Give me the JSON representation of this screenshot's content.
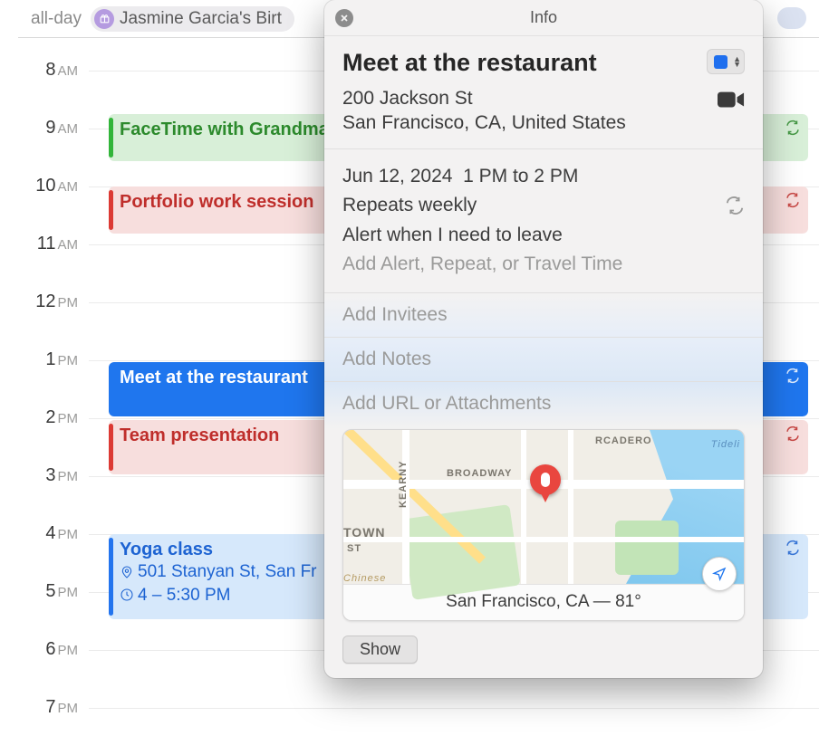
{
  "allDay": {
    "label": "all-day",
    "chip": "Jasmine Garcia's Birt"
  },
  "hours": [
    "8",
    "9",
    "10",
    "11",
    "12",
    "1",
    "2",
    "3",
    "4",
    "5",
    "6",
    "7"
  ],
  "ampm": [
    "AM",
    "AM",
    "AM",
    "AM",
    "PM",
    "PM",
    "PM",
    "PM",
    "PM",
    "PM",
    "PM",
    "PM"
  ],
  "events": {
    "facetime": "FaceTime with Grandma",
    "portfolio": "Portfolio work session",
    "meet": "Meet at the restaurant",
    "team": "Team presentation",
    "yoga": "Yoga class",
    "yoga_loc": "501 Stanyan St, San Fr",
    "yoga_time": "4 – 5:30 PM"
  },
  "pop": {
    "header": "Info",
    "title": "Meet at the restaurant",
    "addr1": "200 Jackson St",
    "addr2": "San Francisco, CA, United States",
    "date": "Jun 12, 2024",
    "time": "1 PM to 2 PM",
    "repeat": "Repeats weekly",
    "alert": "Alert when I need to leave",
    "addAlert": "Add Alert, Repeat, or Travel Time",
    "invitees": "Add Invitees",
    "notes": "Add Notes",
    "url": "Add URL or Attachments",
    "mapFooter": "San Francisco, CA — 81°",
    "show": "Show",
    "mapLabels": {
      "broadway": "BROADWAY",
      "kearny": "KEARNY",
      "rcadero": "RCADERO",
      "town": "TOWN",
      "st": "ST",
      "chinese": "Chinese",
      "tideli": "Tideli"
    }
  }
}
